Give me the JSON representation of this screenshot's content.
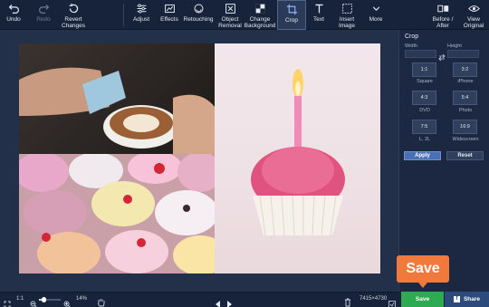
{
  "toolbar": {
    "undo": "Undo",
    "redo": "Redo",
    "revert": "Revert\nChanges",
    "adjust": "Adjust",
    "effects": "Effects",
    "retouching": "Retouching",
    "object_removal": "Object\nRemoval",
    "change_background": "Change\nBackground",
    "crop": "Crop",
    "text": "Text",
    "insert_image": "Insert\nImage",
    "more": "More",
    "before_after": "Before /\nAfter",
    "view_original": "View\nOriginal"
  },
  "panel": {
    "title": "Crop",
    "width_label": "Width",
    "height_label": "Height",
    "ratios": [
      {
        "ratio": "1:1",
        "caption": "Square"
      },
      {
        "ratio": "3:2",
        "caption": "iPhone"
      },
      {
        "ratio": "4:3",
        "caption": "DVD"
      },
      {
        "ratio": "5:4",
        "caption": "Photo"
      },
      {
        "ratio": "7:5",
        "caption": "L, 2L"
      },
      {
        "ratio": "16:9",
        "caption": "Widescreen"
      }
    ],
    "apply": "Apply",
    "reset": "Reset"
  },
  "bottombar": {
    "one_to_one": "1:1",
    "zoom": "14%",
    "dimensions": "7415×4730"
  },
  "actions": {
    "save": "Save",
    "share": "Share",
    "save_callout": "Save"
  },
  "colors": {
    "save": "#2eab52",
    "share": "#2d4a7c",
    "callout": "#f0793b",
    "apply": "#4a6fb2"
  }
}
